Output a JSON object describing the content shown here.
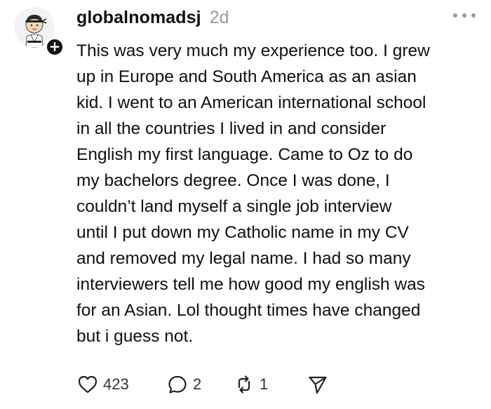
{
  "post": {
    "username": "globalnomadsj",
    "time": "2d",
    "body": "This was very much my experience too. I grew\nup in Europe and South America as an asian\nkid. I went to an American international school\nin all the countries I lived in and consider\nEnglish my first language. Came to Oz to do\nmy bachelors degree. Once I was done, I\ncouldn’t land myself a single job interview\nuntil I put down my Catholic name in my CV\nand removed my legal name. I had so many\ninterviewers tell me how good my english was\nfor an Asian. Lol thought times have changed\nbut i guess not."
  },
  "actions": {
    "likes": "423",
    "replies": "2",
    "reposts": "1"
  },
  "icons": {
    "follow": "plus-icon",
    "more": "more-dots-icon",
    "like": "heart-icon",
    "reply": "comment-bubble-icon",
    "repost": "repost-icon",
    "share": "send-icon"
  },
  "colors": {
    "text": "#101010",
    "muted": "#9a9a9a",
    "background": "#ffffff"
  }
}
